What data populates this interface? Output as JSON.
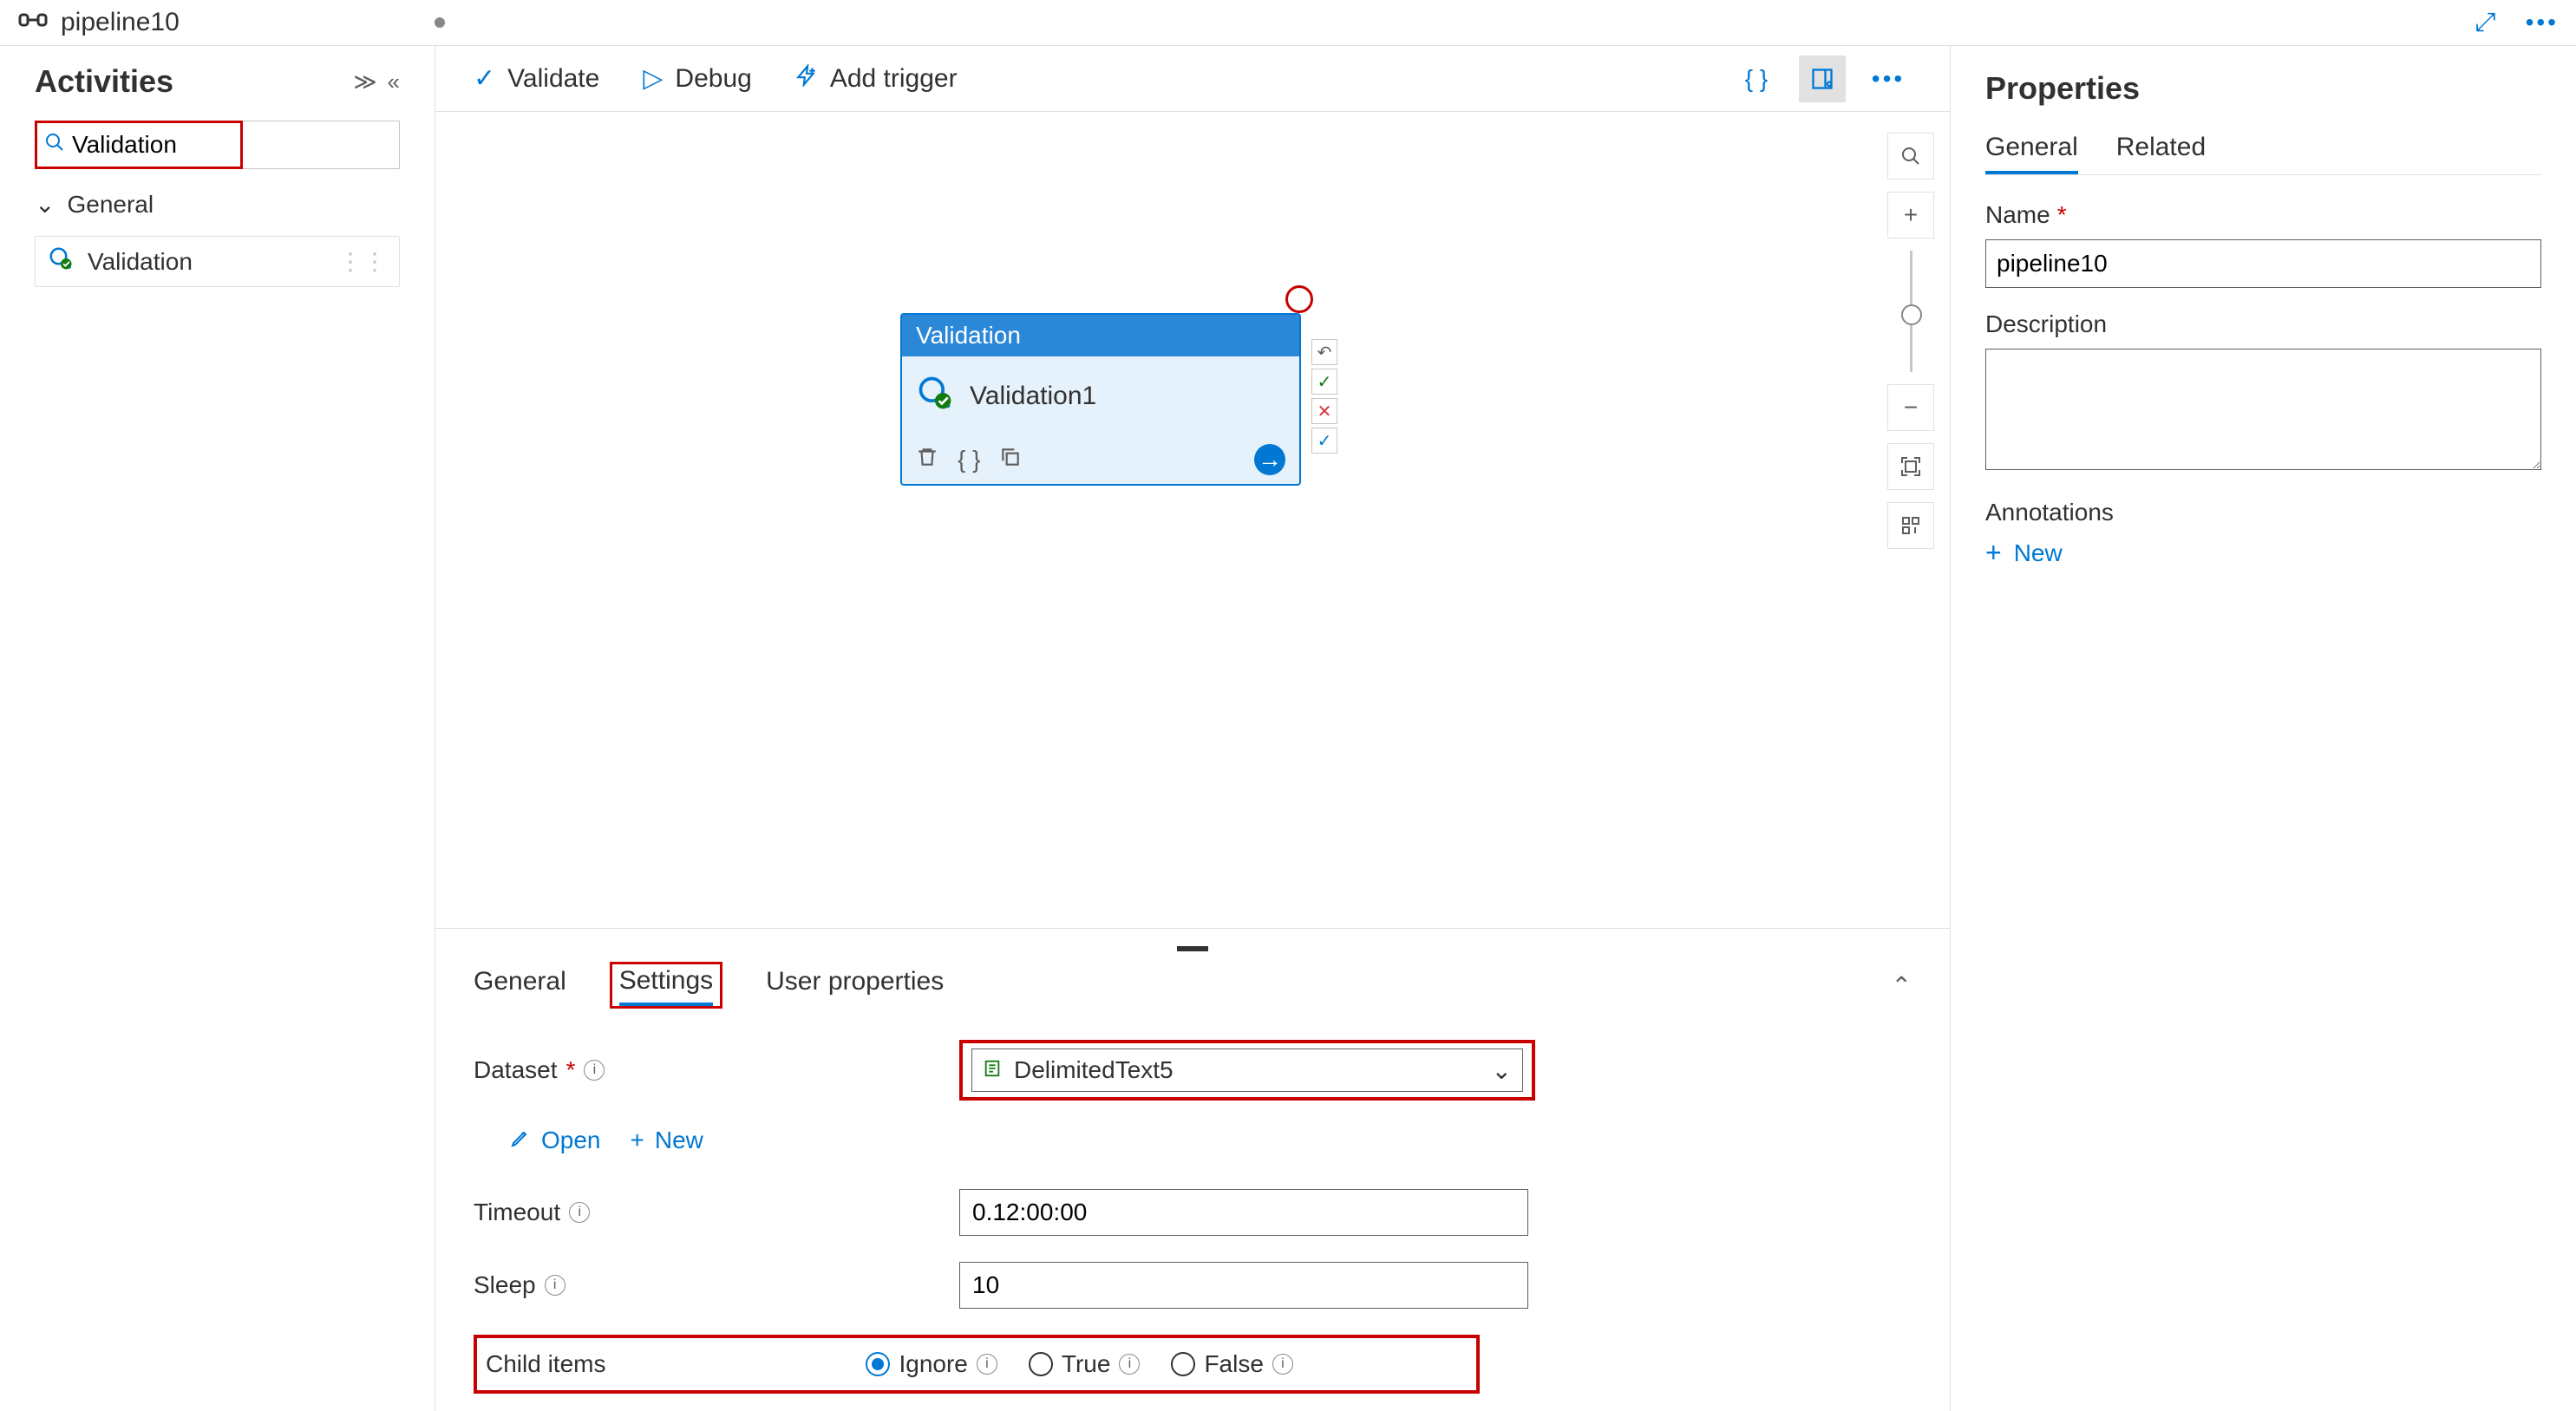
{
  "tab": {
    "title": "pipeline10"
  },
  "activities": {
    "title": "Activities",
    "search_value": "Validation",
    "sections": [
      {
        "name": "General"
      }
    ],
    "items": [
      {
        "label": "Validation"
      }
    ]
  },
  "toolbar": {
    "validate": "Validate",
    "debug": "Debug",
    "add_trigger": "Add trigger"
  },
  "node": {
    "type_label": "Validation",
    "name": "Validation1"
  },
  "bottom_tabs": {
    "general": "General",
    "settings": "Settings",
    "user_props": "User properties"
  },
  "settings": {
    "dataset_label": "Dataset",
    "dataset_value": "DelimitedText5",
    "open": "Open",
    "new": "New",
    "timeout_label": "Timeout",
    "timeout_value": "0.12:00:00",
    "sleep_label": "Sleep",
    "sleep_value": "10",
    "child_label": "Child items",
    "radio_ignore": "Ignore",
    "radio_true": "True",
    "radio_false": "False"
  },
  "properties": {
    "title": "Properties",
    "tab_general": "General",
    "tab_related": "Related",
    "name_label": "Name",
    "name_value": "pipeline10",
    "desc_label": "Description",
    "annotations_label": "Annotations",
    "new": "New"
  }
}
